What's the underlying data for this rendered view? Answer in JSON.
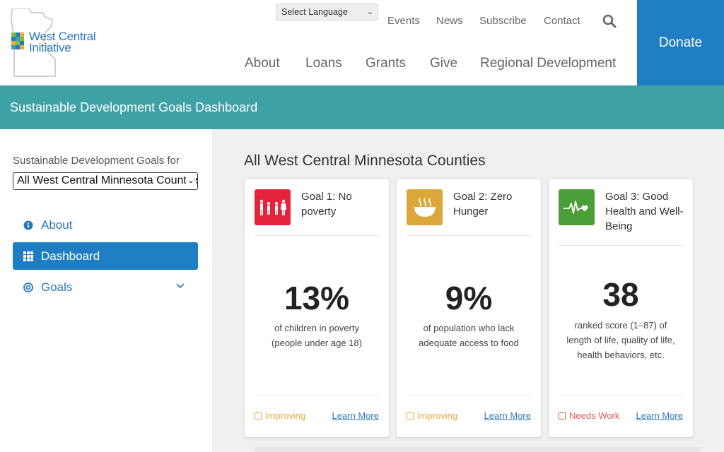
{
  "header": {
    "logo": {
      "line1": "West Central",
      "line2": "Initiative"
    },
    "language_select": "Select Language",
    "top_nav": [
      "Events",
      "News",
      "Subscribe",
      "Contact"
    ],
    "main_nav": [
      "About",
      "Loans",
      "Grants",
      "Give",
      "Regional Development"
    ],
    "donate_label": "Donate"
  },
  "banner": {
    "title": "Sustainable Development Goals Dashboard"
  },
  "sidebar": {
    "label": "Sustainable Development Goals for",
    "region_select": "All West Central Minnesota Counties",
    "items": [
      {
        "label": "About",
        "icon": "info-icon"
      },
      {
        "label": "Dashboard",
        "icon": "grid-icon",
        "active": true
      },
      {
        "label": "Goals",
        "icon": "target-icon"
      }
    ]
  },
  "main": {
    "title": "All West Central Minnesota Counties",
    "cards": [
      {
        "title": "Goal 1: No poverty",
        "metric": "13%",
        "desc": "of children in poverty (people under age 18)",
        "status": "Improving",
        "status_color": "#f0a83c",
        "icon_color": "#e5243b",
        "icon": "family-icon",
        "link": "Learn More"
      },
      {
        "title": "Goal 2: Zero Hunger",
        "metric": "9%",
        "desc": "of population who lack adequate access to food",
        "status": "Improving",
        "status_color": "#f0a83c",
        "icon_color": "#dda63a",
        "icon": "bowl-icon",
        "link": "Learn More"
      },
      {
        "title": "Goal 3: Good Health and Well-Being",
        "metric": "38",
        "desc": "ranked score (1–87) of length of life, quality of life, health behaviors, etc.",
        "status": "Needs Work",
        "status_color": "#e05a5a",
        "icon_color": "#4c9f38",
        "icon": "heartbeat-icon",
        "link": "Learn More"
      }
    ]
  },
  "colors": {
    "accent": "#1f7ec1",
    "banner": "#3ea1a6"
  }
}
